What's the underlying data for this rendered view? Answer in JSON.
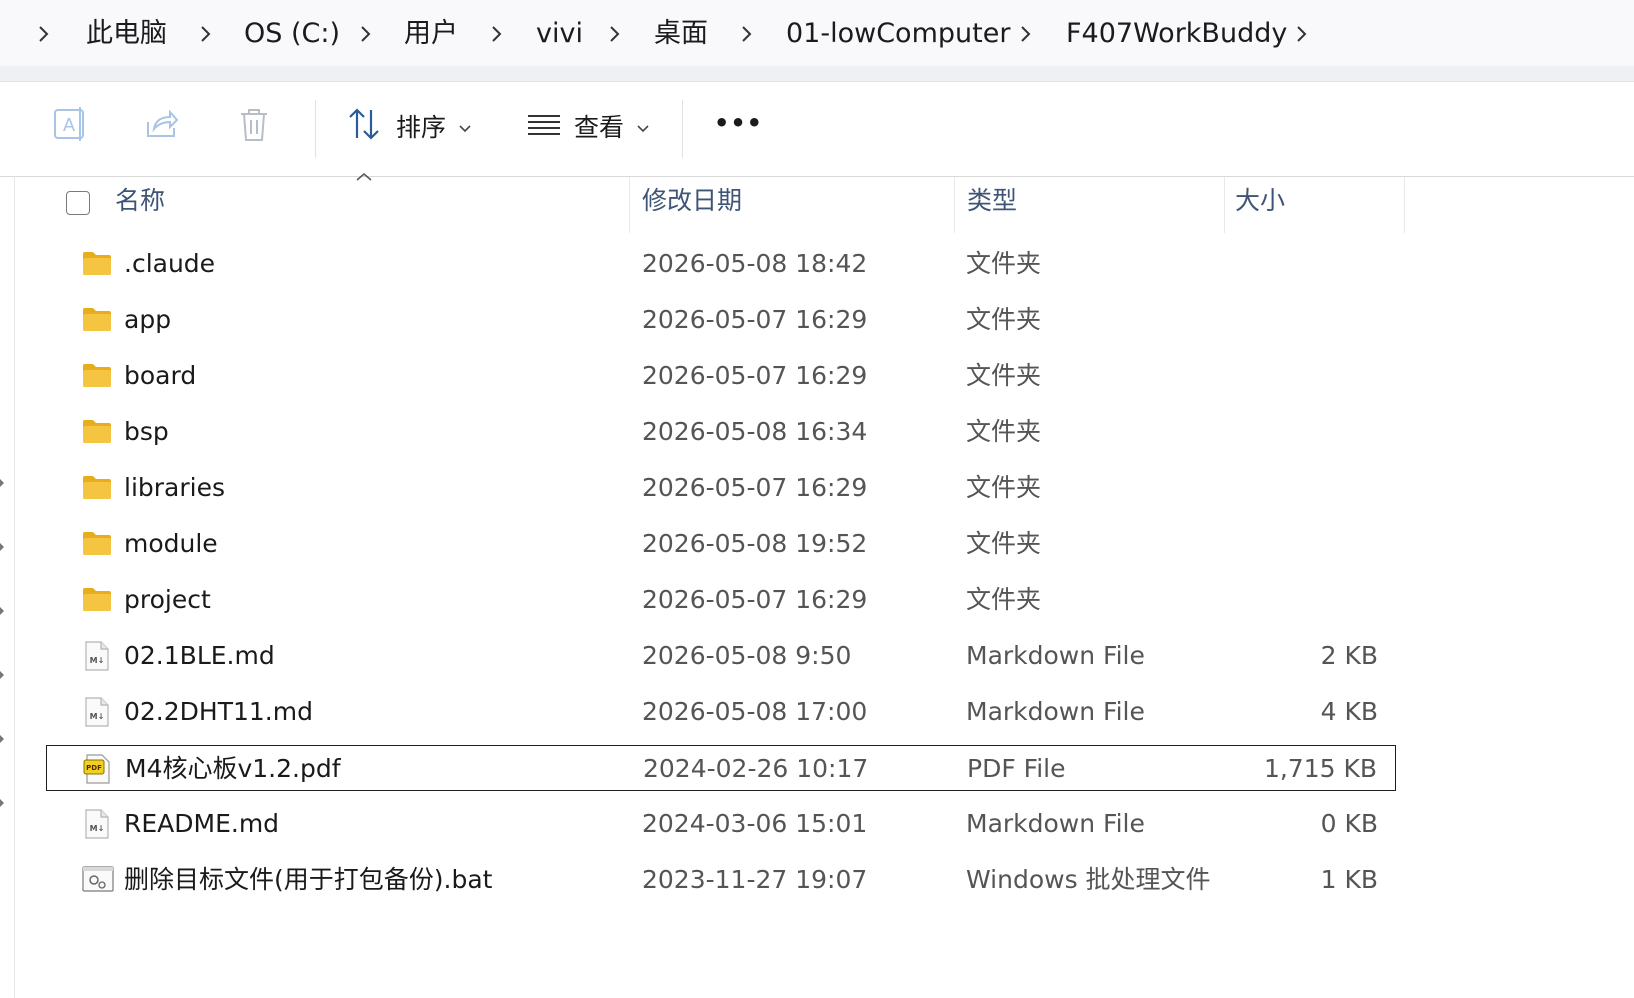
{
  "breadcrumb": [
    {
      "label": "此电脑"
    },
    {
      "label": "OS (C:)"
    },
    {
      "label": "用户"
    },
    {
      "label": "vivi"
    },
    {
      "label": "桌面"
    },
    {
      "label": "01-lowComputer"
    },
    {
      "label": "F407WorkBuddy"
    }
  ],
  "toolbar": {
    "rename_icon": "rename-icon",
    "share_icon": "share-icon",
    "delete_icon": "trash-icon",
    "sort_label": "排序",
    "view_label": "查看",
    "more_label": "•••"
  },
  "columns": {
    "name": "名称",
    "modified": "修改日期",
    "type": "类型",
    "size": "大小"
  },
  "files": [
    {
      "name": ".claude",
      "modified": "2026-05-08 18:42",
      "type": "文件夹",
      "size": "",
      "icon": "folder-icon"
    },
    {
      "name": "app",
      "modified": "2026-05-07 16:29",
      "type": "文件夹",
      "size": "",
      "icon": "folder-icon"
    },
    {
      "name": "board",
      "modified": "2026-05-07 16:29",
      "type": "文件夹",
      "size": "",
      "icon": "folder-icon"
    },
    {
      "name": "bsp",
      "modified": "2026-05-08 16:34",
      "type": "文件夹",
      "size": "",
      "icon": "folder-icon"
    },
    {
      "name": "libraries",
      "modified": "2026-05-07 16:29",
      "type": "文件夹",
      "size": "",
      "icon": "folder-icon"
    },
    {
      "name": "module",
      "modified": "2026-05-08 19:52",
      "type": "文件夹",
      "size": "",
      "icon": "folder-icon"
    },
    {
      "name": "project",
      "modified": "2026-05-07 16:29",
      "type": "文件夹",
      "size": "",
      "icon": "folder-icon"
    },
    {
      "name": "02.1BLE.md",
      "modified": "2026-05-08 9:50",
      "type": "Markdown File",
      "size": "2 KB",
      "icon": "markdown-file-icon"
    },
    {
      "name": "02.2DHT11.md",
      "modified": "2026-05-08 17:00",
      "type": "Markdown File",
      "size": "4 KB",
      "icon": "markdown-file-icon"
    },
    {
      "name": "M4核心板v1.2.pdf",
      "modified": "2024-02-26 10:17",
      "type": "PDF File",
      "size": "1,715 KB",
      "icon": "pdf-file-icon",
      "selected": true
    },
    {
      "name": "README.md",
      "modified": "2024-03-06 15:01",
      "type": "Markdown File",
      "size": "0 KB",
      "icon": "markdown-file-icon"
    },
    {
      "name": "删除目标文件(用于打包备份).bat",
      "modified": "2023-11-27 19:07",
      "type": "Windows 批处理文件",
      "size": "1 KB",
      "icon": "batch-file-icon"
    }
  ],
  "colors": {
    "folder": "#f5c542",
    "folder_dark": "#e6ad1f",
    "header_text": "#3f5575",
    "selection_border": "#1d1d1d"
  }
}
